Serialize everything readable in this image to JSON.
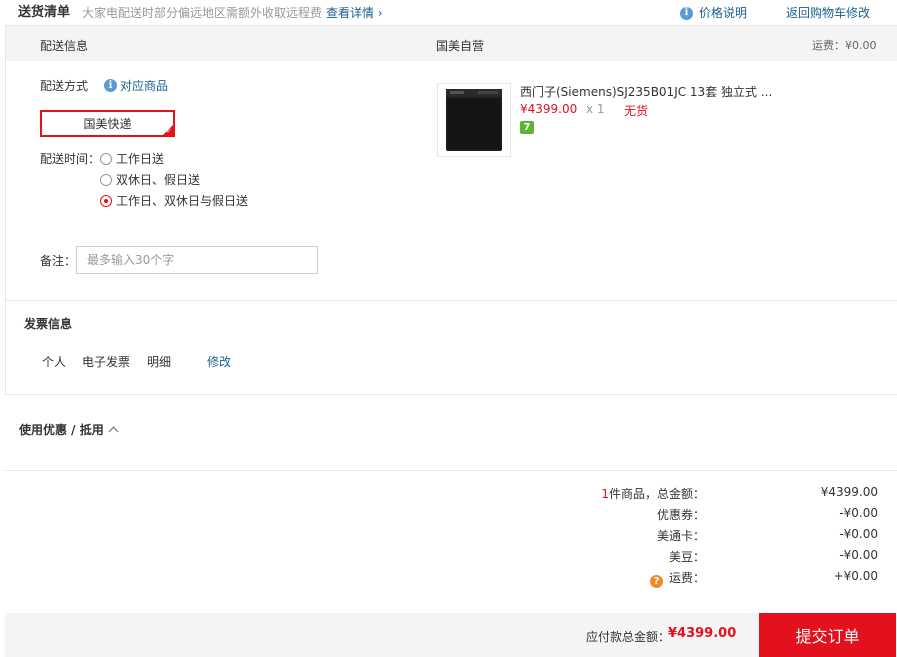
{
  "header": {
    "title": "送货清单",
    "note": "大家电配送时部分偏远地区需额外收取远程费",
    "detail_link": "查看详情 ›",
    "price_explain": "价格说明",
    "back_to_cart": "返回购物车修改"
  },
  "section_head": {
    "delivery_info": "配送信息",
    "seller": "国美自营",
    "shipping_fee": "运费：¥0.00"
  },
  "delivery": {
    "method_label": "配送方式",
    "match_goods": "对应商品",
    "express_label": "国美快递",
    "time_label": "配送时间：",
    "time_options": [
      {
        "label": "工作日送",
        "selected": false
      },
      {
        "label": "双休日、假日送",
        "selected": false
      },
      {
        "label": "工作日、双休日与假日送",
        "selected": true
      }
    ],
    "note_label": "备注：",
    "note_placeholder": "最多输入30个字"
  },
  "product": {
    "name": "西门子(Siemens)SJ235B01JC 13套 独立式 ...",
    "price": "¥4399.00",
    "qty": "x 1",
    "stock": "无货",
    "badge": "7"
  },
  "invoice": {
    "title": "发票信息",
    "type": "个人",
    "kind": "电子发票",
    "content": "明细",
    "modify": "修改"
  },
  "coupon": {
    "title": "使用优惠 / 抵用"
  },
  "summary": {
    "count": "1",
    "count_suffix": "件商品，总金额：",
    "total": "¥4399.00",
    "coupon_label": "优惠券：",
    "coupon_value": "-¥0.00",
    "card_label": "美通卡：",
    "card_value": "-¥0.00",
    "bean_label": "美豆：",
    "bean_value": "-¥0.00",
    "fee_label": "运费：",
    "fee_value": "+¥0.00"
  },
  "footer": {
    "pay_label": "应付款总金额：",
    "pay_amount": "¥4399.00",
    "submit": "提交订单"
  },
  "colors": {
    "accent_red": "#e3101e",
    "link_blue": "#1a5f8f",
    "badge_green": "#5cb531"
  }
}
